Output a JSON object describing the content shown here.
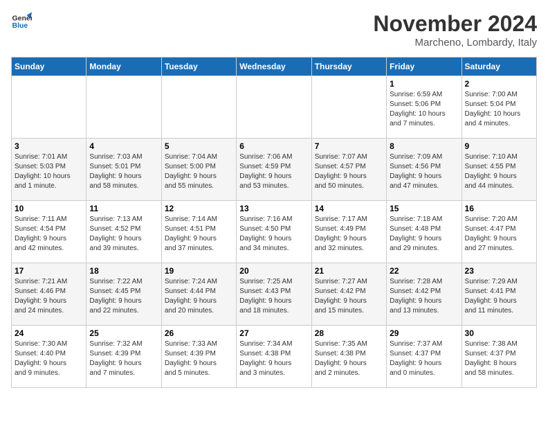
{
  "logo": {
    "line1": "General",
    "line2": "Blue"
  },
  "title": "November 2024",
  "location": "Marcheno, Lombardy, Italy",
  "days_of_week": [
    "Sunday",
    "Monday",
    "Tuesday",
    "Wednesday",
    "Thursday",
    "Friday",
    "Saturday"
  ],
  "weeks": [
    [
      {
        "day": "",
        "info": ""
      },
      {
        "day": "",
        "info": ""
      },
      {
        "day": "",
        "info": ""
      },
      {
        "day": "",
        "info": ""
      },
      {
        "day": "",
        "info": ""
      },
      {
        "day": "1",
        "info": "Sunrise: 6:59 AM\nSunset: 5:06 PM\nDaylight: 10 hours\nand 7 minutes."
      },
      {
        "day": "2",
        "info": "Sunrise: 7:00 AM\nSunset: 5:04 PM\nDaylight: 10 hours\nand 4 minutes."
      }
    ],
    [
      {
        "day": "3",
        "info": "Sunrise: 7:01 AM\nSunset: 5:03 PM\nDaylight: 10 hours\nand 1 minute."
      },
      {
        "day": "4",
        "info": "Sunrise: 7:03 AM\nSunset: 5:01 PM\nDaylight: 9 hours\nand 58 minutes."
      },
      {
        "day": "5",
        "info": "Sunrise: 7:04 AM\nSunset: 5:00 PM\nDaylight: 9 hours\nand 55 minutes."
      },
      {
        "day": "6",
        "info": "Sunrise: 7:06 AM\nSunset: 4:59 PM\nDaylight: 9 hours\nand 53 minutes."
      },
      {
        "day": "7",
        "info": "Sunrise: 7:07 AM\nSunset: 4:57 PM\nDaylight: 9 hours\nand 50 minutes."
      },
      {
        "day": "8",
        "info": "Sunrise: 7:09 AM\nSunset: 4:56 PM\nDaylight: 9 hours\nand 47 minutes."
      },
      {
        "day": "9",
        "info": "Sunrise: 7:10 AM\nSunset: 4:55 PM\nDaylight: 9 hours\nand 44 minutes."
      }
    ],
    [
      {
        "day": "10",
        "info": "Sunrise: 7:11 AM\nSunset: 4:54 PM\nDaylight: 9 hours\nand 42 minutes."
      },
      {
        "day": "11",
        "info": "Sunrise: 7:13 AM\nSunset: 4:52 PM\nDaylight: 9 hours\nand 39 minutes."
      },
      {
        "day": "12",
        "info": "Sunrise: 7:14 AM\nSunset: 4:51 PM\nDaylight: 9 hours\nand 37 minutes."
      },
      {
        "day": "13",
        "info": "Sunrise: 7:16 AM\nSunset: 4:50 PM\nDaylight: 9 hours\nand 34 minutes."
      },
      {
        "day": "14",
        "info": "Sunrise: 7:17 AM\nSunset: 4:49 PM\nDaylight: 9 hours\nand 32 minutes."
      },
      {
        "day": "15",
        "info": "Sunrise: 7:18 AM\nSunset: 4:48 PM\nDaylight: 9 hours\nand 29 minutes."
      },
      {
        "day": "16",
        "info": "Sunrise: 7:20 AM\nSunset: 4:47 PM\nDaylight: 9 hours\nand 27 minutes."
      }
    ],
    [
      {
        "day": "17",
        "info": "Sunrise: 7:21 AM\nSunset: 4:46 PM\nDaylight: 9 hours\nand 24 minutes."
      },
      {
        "day": "18",
        "info": "Sunrise: 7:22 AM\nSunset: 4:45 PM\nDaylight: 9 hours\nand 22 minutes."
      },
      {
        "day": "19",
        "info": "Sunrise: 7:24 AM\nSunset: 4:44 PM\nDaylight: 9 hours\nand 20 minutes."
      },
      {
        "day": "20",
        "info": "Sunrise: 7:25 AM\nSunset: 4:43 PM\nDaylight: 9 hours\nand 18 minutes."
      },
      {
        "day": "21",
        "info": "Sunrise: 7:27 AM\nSunset: 4:42 PM\nDaylight: 9 hours\nand 15 minutes."
      },
      {
        "day": "22",
        "info": "Sunrise: 7:28 AM\nSunset: 4:42 PM\nDaylight: 9 hours\nand 13 minutes."
      },
      {
        "day": "23",
        "info": "Sunrise: 7:29 AM\nSunset: 4:41 PM\nDaylight: 9 hours\nand 11 minutes."
      }
    ],
    [
      {
        "day": "24",
        "info": "Sunrise: 7:30 AM\nSunset: 4:40 PM\nDaylight: 9 hours\nand 9 minutes."
      },
      {
        "day": "25",
        "info": "Sunrise: 7:32 AM\nSunset: 4:39 PM\nDaylight: 9 hours\nand 7 minutes."
      },
      {
        "day": "26",
        "info": "Sunrise: 7:33 AM\nSunset: 4:39 PM\nDaylight: 9 hours\nand 5 minutes."
      },
      {
        "day": "27",
        "info": "Sunrise: 7:34 AM\nSunset: 4:38 PM\nDaylight: 9 hours\nand 3 minutes."
      },
      {
        "day": "28",
        "info": "Sunrise: 7:35 AM\nSunset: 4:38 PM\nDaylight: 9 hours\nand 2 minutes."
      },
      {
        "day": "29",
        "info": "Sunrise: 7:37 AM\nSunset: 4:37 PM\nDaylight: 9 hours\nand 0 minutes."
      },
      {
        "day": "30",
        "info": "Sunrise: 7:38 AM\nSunset: 4:37 PM\nDaylight: 8 hours\nand 58 minutes."
      }
    ]
  ]
}
